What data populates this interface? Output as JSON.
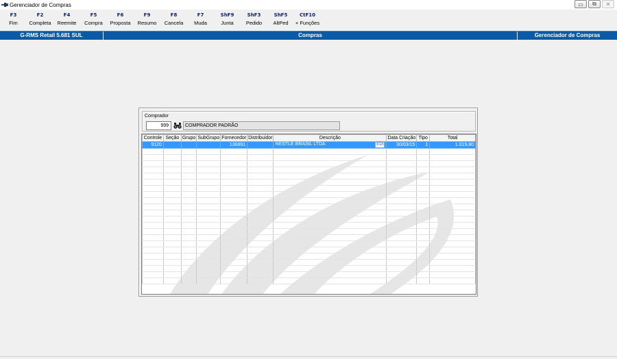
{
  "window": {
    "title": "Gerenciador de Compras"
  },
  "toolbar": [
    {
      "key": "F3",
      "label": "Fim"
    },
    {
      "key": "F2",
      "label": "Completa"
    },
    {
      "key": "F4",
      "label": "Reemite"
    },
    {
      "key": "F5",
      "label": "Compra"
    },
    {
      "key": "F6",
      "label": "Proposta"
    },
    {
      "key": "F9",
      "label": "Resumo"
    },
    {
      "key": "F8",
      "label": "Cancela"
    },
    {
      "key": "F7",
      "label": "Muda"
    },
    {
      "key": "ShF9",
      "label": "Junta"
    },
    {
      "key": "ShF3",
      "label": "Pedido"
    },
    {
      "key": "ShF5",
      "label": "AltPed"
    },
    {
      "key": "CtF10",
      "label": "+ Funções"
    }
  ],
  "status": {
    "left": "G-RMS Retail 5.681 SUL",
    "center": "Compras",
    "right": "Gerenciador de Compras"
  },
  "comprador": {
    "label": "Comprador",
    "code": "999",
    "name": "COMPRADOR PADRÃO"
  },
  "grid": {
    "columns": [
      "Controle",
      "Seção",
      "Grupo",
      "SubGrupo",
      "Fornecedor",
      "Distribuidor",
      "Descrição",
      "Data Criação",
      "Tipo",
      "Total"
    ],
    "rows": [
      {
        "controle": "9120",
        "secao": "",
        "grupo": "",
        "subgrupo": "",
        "fornecedor": "136891",
        "distribuidor": "",
        "descricao": "NESTLE BRASIL LTDA",
        "tag": "EDI",
        "data": "30/03/15",
        "tipo": "1",
        "total": "1.019,80"
      }
    ]
  },
  "colors": {
    "accent": "#0a5aa8",
    "selection": "#3399ff"
  }
}
